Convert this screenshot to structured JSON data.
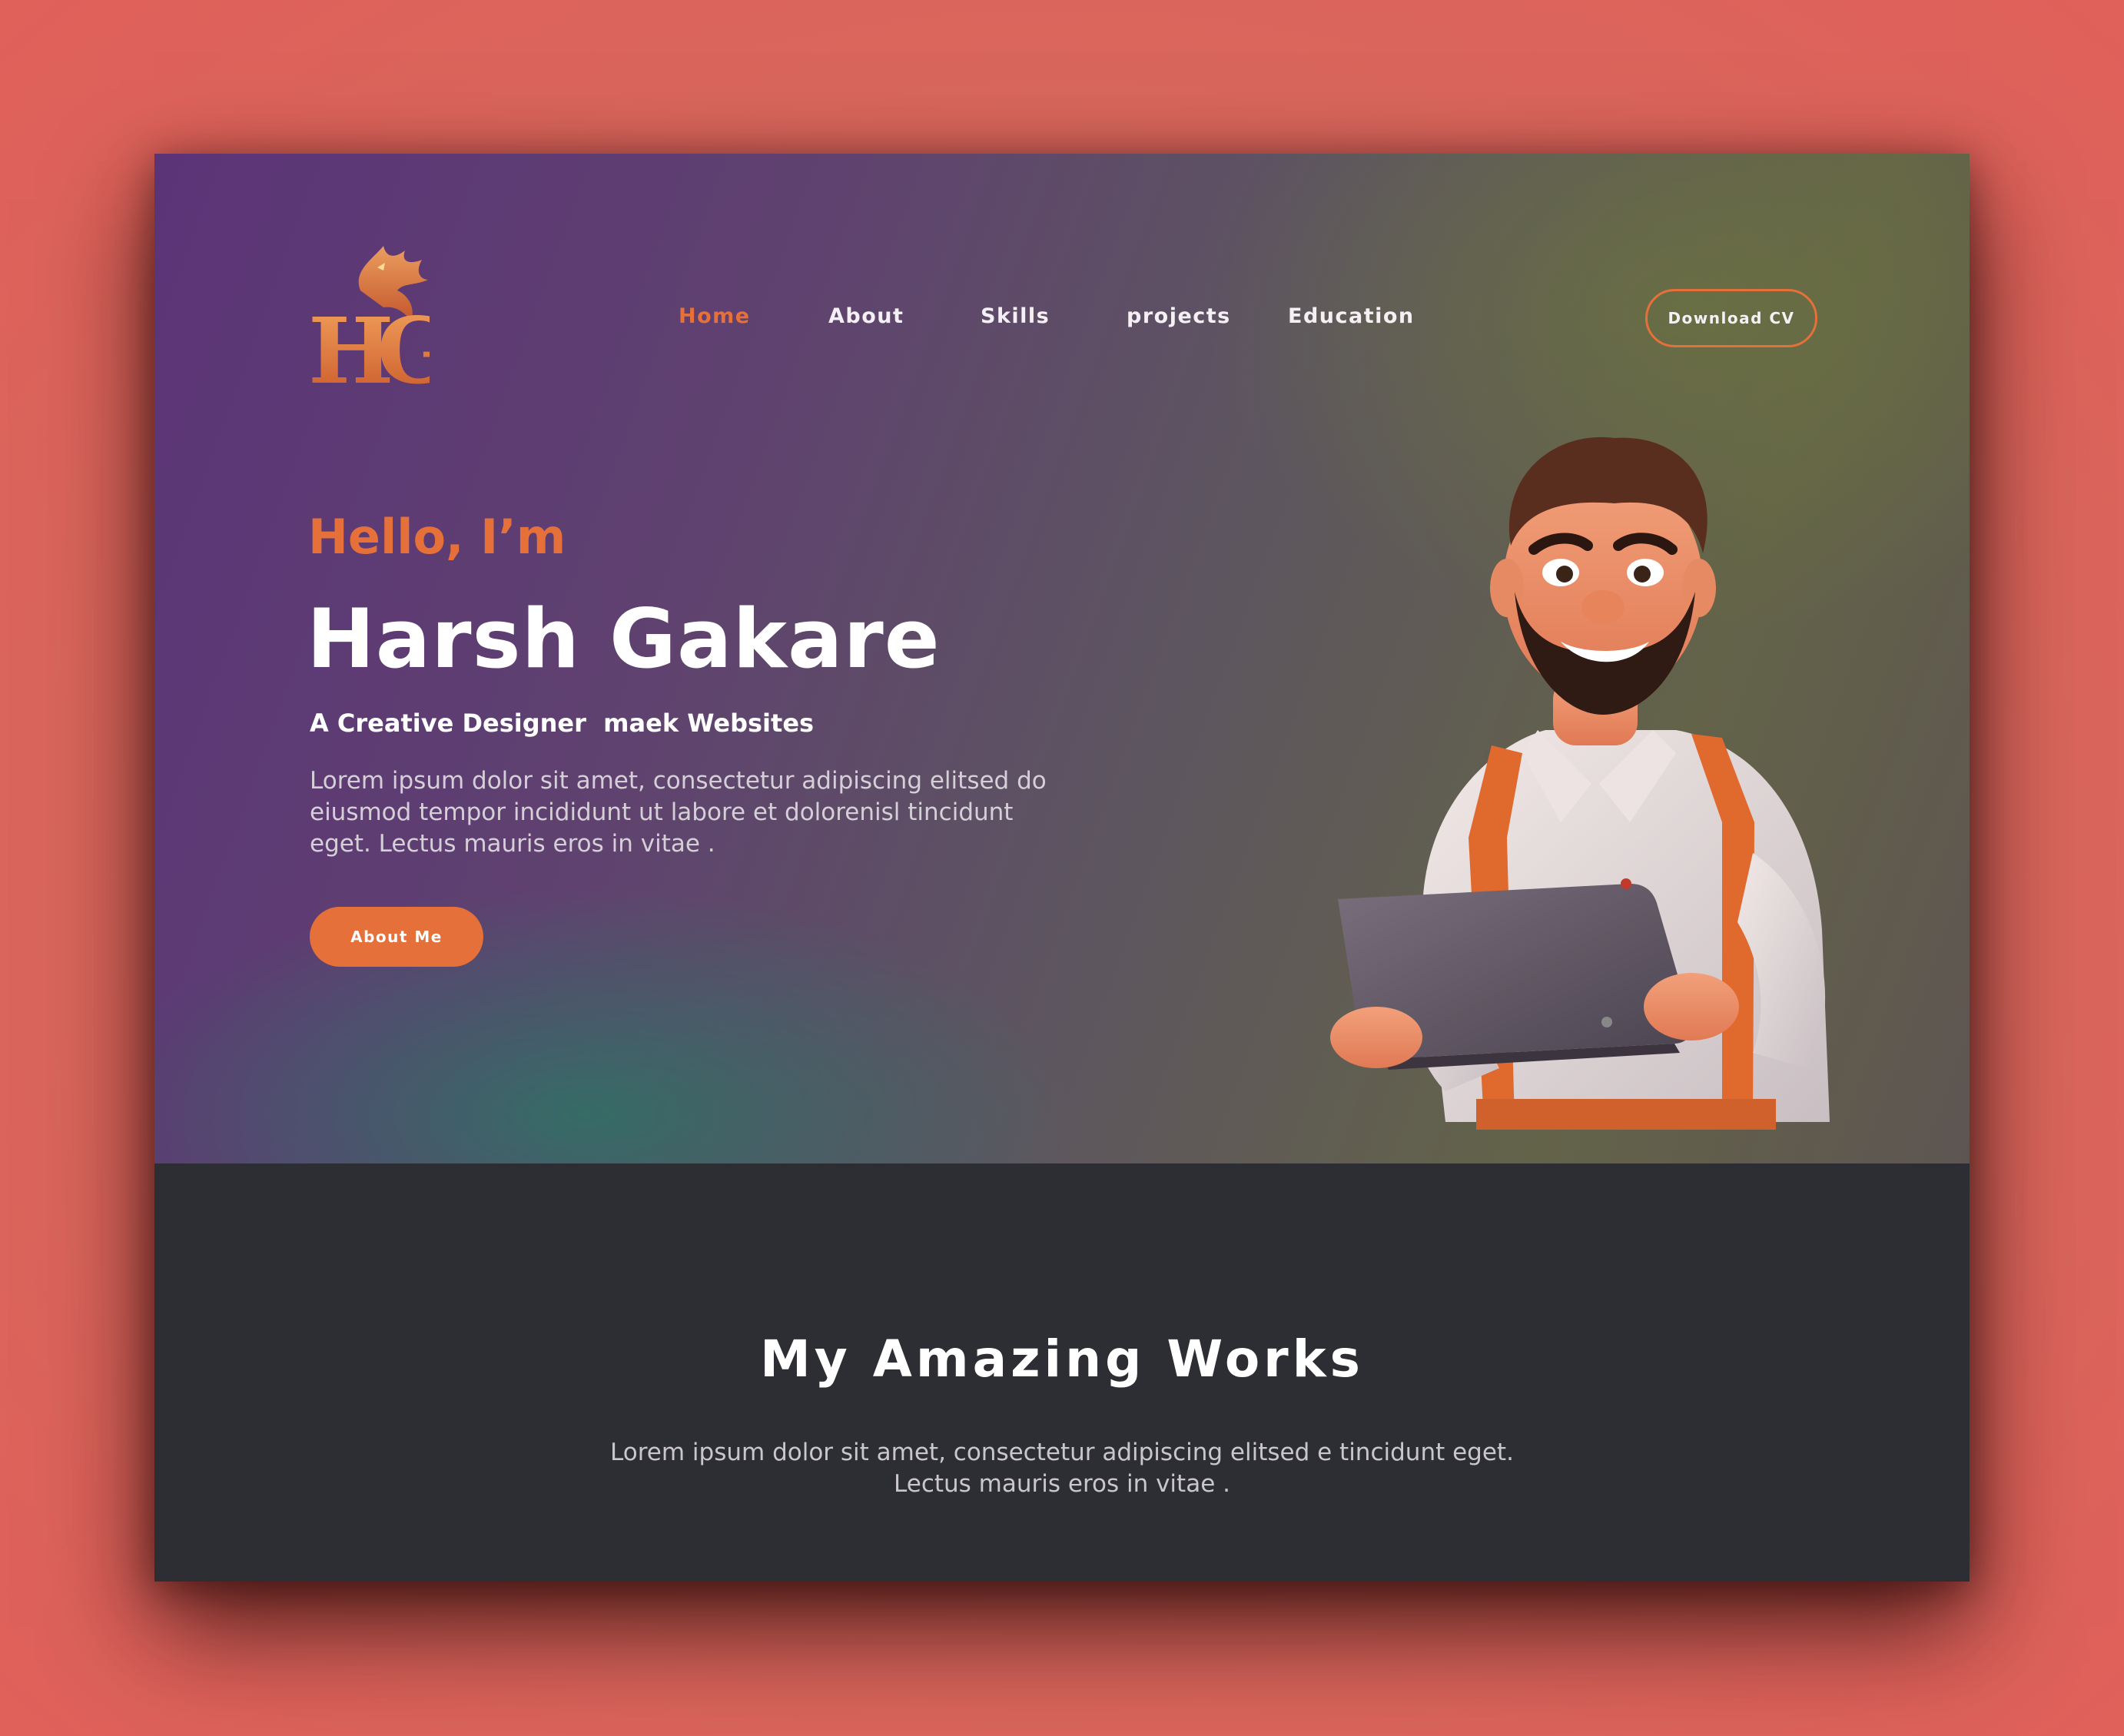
{
  "brand": {
    "logo_letters": "HG"
  },
  "nav": {
    "items": [
      {
        "label": "Home",
        "active": true
      },
      {
        "label": "About",
        "active": false
      },
      {
        "label": "Skills",
        "active": false
      },
      {
        "label": "projects",
        "active": false
      },
      {
        "label": "Education",
        "active": false
      }
    ],
    "cta_label": "Download CV"
  },
  "hero": {
    "greeting": "Hello, I’m",
    "name": "Harsh Gakare",
    "tagline": "A Creative Designer  maek Websites",
    "intro": "Lorem ipsum dolor sit amet, consectetur adipiscing elitsed do eiusmod tempor incididunt ut labore et dolorenisl tincidunt eget. Lectus mauris eros in vitae .",
    "button_label": "About Me"
  },
  "works": {
    "title": "My Amazing Works",
    "text": "Lorem ipsum dolor sit amet, consectetur adipiscing elitsed e tincidunt eget. Lectus mauris eros in vitae ."
  },
  "colors": {
    "accent": "#e5703a",
    "hero_purple": "#5b3478",
    "hero_olive": "#636349",
    "works_bg": "#2d2e34",
    "page_bg": "#d7685d"
  },
  "icons": {
    "logo": "dragon-hg-monogram",
    "illustration": "developer-with-laptop-avatar"
  }
}
